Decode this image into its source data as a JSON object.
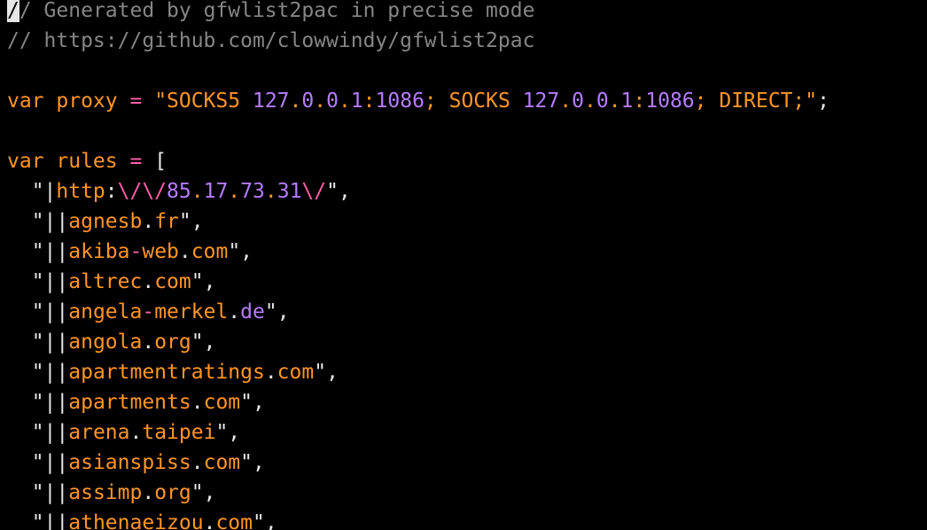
{
  "editor": {
    "lines": [
      [
        {
          "text": "/",
          "type": "cursor"
        },
        {
          "text": "/ Generated by gfwlist2pac in precise mode",
          "type": "comment"
        }
      ],
      [
        {
          "text": "// https://github.com/clowwindy/gfwlist2pac",
          "type": "comment"
        }
      ],
      [],
      [
        {
          "text": "var",
          "type": "keyword"
        },
        {
          "text": " proxy ",
          "type": "ident"
        },
        {
          "text": "=",
          "type": "op"
        },
        {
          "text": " \"SOCKS5 ",
          "type": "string"
        },
        {
          "text": "127",
          "type": "number"
        },
        {
          "text": ".",
          "type": "string"
        },
        {
          "text": "0",
          "type": "number"
        },
        {
          "text": ".",
          "type": "string"
        },
        {
          "text": "0",
          "type": "number"
        },
        {
          "text": ".",
          "type": "string"
        },
        {
          "text": "1",
          "type": "number"
        },
        {
          "text": ":",
          "type": "string"
        },
        {
          "text": "1086",
          "type": "number"
        },
        {
          "text": "; SOCKS ",
          "type": "string"
        },
        {
          "text": "127",
          "type": "number"
        },
        {
          "text": ".",
          "type": "string"
        },
        {
          "text": "0",
          "type": "number"
        },
        {
          "text": ".",
          "type": "string"
        },
        {
          "text": "0",
          "type": "number"
        },
        {
          "text": ".",
          "type": "string"
        },
        {
          "text": "1",
          "type": "number"
        },
        {
          "text": ":",
          "type": "string"
        },
        {
          "text": "1086",
          "type": "number"
        },
        {
          "text": "; DIRECT;\"",
          "type": "string"
        },
        {
          "text": ";",
          "type": "punct"
        }
      ],
      [],
      [
        {
          "text": "var",
          "type": "keyword"
        },
        {
          "text": " rules ",
          "type": "ident"
        },
        {
          "text": "=",
          "type": "op"
        },
        {
          "text": " [",
          "type": "punct"
        }
      ],
      [
        {
          "text": "  \"|",
          "type": "punct"
        },
        {
          "text": "http",
          "type": "string"
        },
        {
          "text": ":",
          "type": "punct"
        },
        {
          "text": "\\/\\/",
          "type": "slash"
        },
        {
          "text": "85",
          "type": "number"
        },
        {
          "text": ".",
          "type": "string"
        },
        {
          "text": "17",
          "type": "number"
        },
        {
          "text": ".",
          "type": "string"
        },
        {
          "text": "73",
          "type": "number"
        },
        {
          "text": ".",
          "type": "string"
        },
        {
          "text": "31",
          "type": "number"
        },
        {
          "text": "\\/",
          "type": "slash"
        },
        {
          "text": "\",",
          "type": "punct"
        }
      ],
      [
        {
          "text": "  \"||",
          "type": "punct"
        },
        {
          "text": "agnesb",
          "type": "string"
        },
        {
          "text": ".",
          "type": "punct"
        },
        {
          "text": "fr",
          "type": "string"
        },
        {
          "text": "\",",
          "type": "punct"
        }
      ],
      [
        {
          "text": "  \"||",
          "type": "punct"
        },
        {
          "text": "akiba",
          "type": "string"
        },
        {
          "text": "-",
          "type": "op"
        },
        {
          "text": "web",
          "type": "string"
        },
        {
          "text": ".",
          "type": "punct"
        },
        {
          "text": "com",
          "type": "string"
        },
        {
          "text": "\",",
          "type": "punct"
        }
      ],
      [
        {
          "text": "  \"||",
          "type": "punct"
        },
        {
          "text": "altrec",
          "type": "string"
        },
        {
          "text": ".",
          "type": "punct"
        },
        {
          "text": "com",
          "type": "string"
        },
        {
          "text": "\",",
          "type": "punct"
        }
      ],
      [
        {
          "text": "  \"||",
          "type": "punct"
        },
        {
          "text": "angela",
          "type": "string"
        },
        {
          "text": "-",
          "type": "op"
        },
        {
          "text": "merkel",
          "type": "string"
        },
        {
          "text": ".",
          "type": "punct"
        },
        {
          "text": "de",
          "type": "number"
        },
        {
          "text": "\",",
          "type": "punct"
        }
      ],
      [
        {
          "text": "  \"||",
          "type": "punct"
        },
        {
          "text": "angola",
          "type": "string"
        },
        {
          "text": ".",
          "type": "punct"
        },
        {
          "text": "org",
          "type": "string"
        },
        {
          "text": "\",",
          "type": "punct"
        }
      ],
      [
        {
          "text": "  \"||",
          "type": "punct"
        },
        {
          "text": "apartmentratings",
          "type": "string"
        },
        {
          "text": ".",
          "type": "punct"
        },
        {
          "text": "com",
          "type": "string"
        },
        {
          "text": "\",",
          "type": "punct"
        }
      ],
      [
        {
          "text": "  \"||",
          "type": "punct"
        },
        {
          "text": "apartments",
          "type": "string"
        },
        {
          "text": ".",
          "type": "punct"
        },
        {
          "text": "com",
          "type": "string"
        },
        {
          "text": "\",",
          "type": "punct"
        }
      ],
      [
        {
          "text": "  \"||",
          "type": "punct"
        },
        {
          "text": "arena",
          "type": "string"
        },
        {
          "text": ".",
          "type": "punct"
        },
        {
          "text": "taipei",
          "type": "string"
        },
        {
          "text": "\",",
          "type": "punct"
        }
      ],
      [
        {
          "text": "  \"||",
          "type": "punct"
        },
        {
          "text": "asianspiss",
          "type": "string"
        },
        {
          "text": ".",
          "type": "punct"
        },
        {
          "text": "com",
          "type": "string"
        },
        {
          "text": "\",",
          "type": "punct"
        }
      ],
      [
        {
          "text": "  \"||",
          "type": "punct"
        },
        {
          "text": "assimp",
          "type": "string"
        },
        {
          "text": ".",
          "type": "punct"
        },
        {
          "text": "org",
          "type": "string"
        },
        {
          "text": "\",",
          "type": "punct"
        }
      ],
      [
        {
          "text": "  \"||",
          "type": "punct"
        },
        {
          "text": "athenaeizou",
          "type": "string"
        },
        {
          "text": ".",
          "type": "punct"
        },
        {
          "text": "com",
          "type": "string"
        },
        {
          "text": "\",",
          "type": "punct"
        }
      ]
    ]
  }
}
